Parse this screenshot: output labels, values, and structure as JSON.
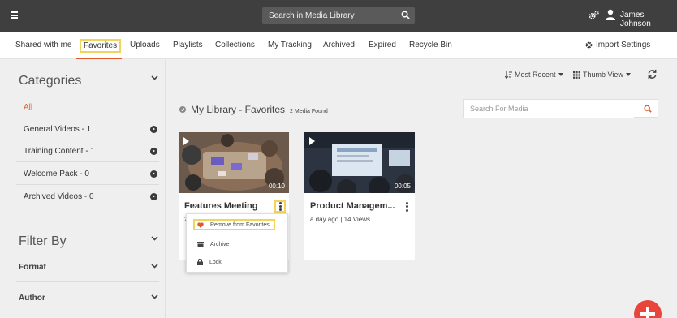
{
  "topbar": {
    "search_placeholder": "Search in Media Library",
    "user_name": "James Johnson"
  },
  "tabs": [
    {
      "label": "Shared with me"
    },
    {
      "label": "Favorites"
    },
    {
      "label": "Uploads"
    },
    {
      "label": "Playlists"
    },
    {
      "label": "Collections"
    },
    {
      "label": "My Tracking"
    },
    {
      "label": "Archived"
    },
    {
      "label": "Expired"
    },
    {
      "label": "Recycle Bin"
    }
  ],
  "import_settings_label": "Import Settings",
  "sidebar": {
    "categories_title": "Categories",
    "items": [
      {
        "label": "All"
      },
      {
        "label": "General Videos - 1"
      },
      {
        "label": "Training Content - 1"
      },
      {
        "label": "Welcome Pack - 0"
      },
      {
        "label": "Archived Videos - 0"
      }
    ],
    "filter_title": "Filter By",
    "filters": [
      {
        "label": "Format"
      },
      {
        "label": "Author"
      }
    ]
  },
  "toolbar": {
    "sort_label": "Most Recent",
    "view_label": "Thumb View",
    "search_placeholder": "Search For Media"
  },
  "library": {
    "title": "My Library - Favorites",
    "count": "2 Media Found"
  },
  "media": [
    {
      "title": "Features Meeting",
      "duration": "00:10",
      "meta": "2"
    },
    {
      "title": "Product Managem...",
      "duration": "00:05",
      "meta": "a day ago  |  14 Views"
    }
  ],
  "menu": {
    "items": [
      {
        "label": "Remove from Favorites"
      },
      {
        "label": "Archive"
      },
      {
        "label": "Lock"
      }
    ]
  },
  "colors": {
    "accent": "#e05a2b",
    "highlight": "#f0d45e",
    "topbar": "#3f3f3f",
    "fab": "#e8453c"
  }
}
